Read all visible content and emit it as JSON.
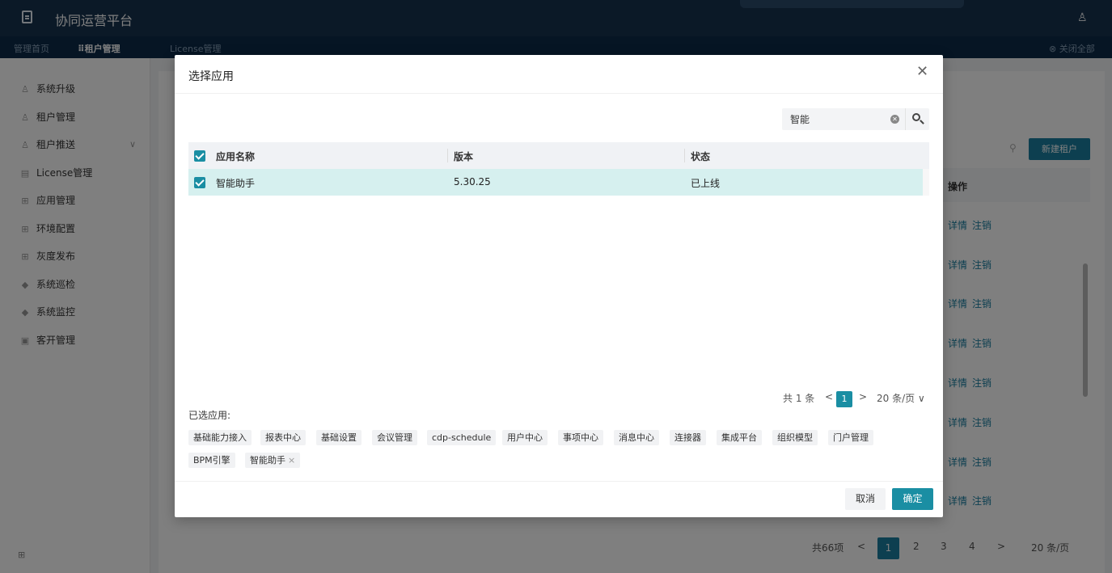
{
  "app": {
    "title": "协同运营平台"
  },
  "tabs": [
    {
      "label": "管理首页"
    },
    {
      "label": "⠿租户管理"
    },
    {
      "label": "License管理"
    }
  ],
  "close_all": "⊗ 关闭全部",
  "sidebar": {
    "items": [
      {
        "label": "系统升级",
        "icon": "user-icon"
      },
      {
        "label": "租户管理",
        "icon": "user-icon"
      },
      {
        "label": "租户推送",
        "icon": "user-icon"
      },
      {
        "label": "License管理",
        "icon": "license-icon"
      },
      {
        "label": "应用管理",
        "icon": "app-icon"
      },
      {
        "label": "环境配置",
        "icon": "app-icon"
      },
      {
        "label": "灰度发布",
        "icon": "grid-icon"
      },
      {
        "label": "系统巡检",
        "icon": "shield-icon"
      },
      {
        "label": "系统监控",
        "icon": "shield-icon"
      },
      {
        "label": "客开管理",
        "icon": "doc-icon"
      }
    ]
  },
  "background": {
    "new_tenant_label": "新建租户",
    "ops_header": "操作",
    "row_actions": [
      "详情",
      "注销"
    ],
    "pager": {
      "total": "共66项",
      "pages": [
        "1",
        "2",
        "3",
        "4"
      ],
      "page_size": "20 条/页"
    }
  },
  "modal": {
    "title": "选择应用",
    "search": {
      "value": "智能"
    },
    "table": {
      "headers": [
        "应用名称",
        "版本",
        "状态"
      ],
      "rows": [
        {
          "name": "智能助手",
          "version": "5.30.25",
          "status": "已上线"
        }
      ]
    },
    "pager": {
      "total": "共 1 条",
      "current": "1",
      "page_size": "20 条/页"
    },
    "selected_label": "已选应用:",
    "selected_apps": [
      "基础能力接入",
      "报表中心",
      "基础设置",
      "会议管理",
      "cdp-schedule",
      "用户中心",
      "事项中心",
      "消息中心",
      "连接器",
      "集成平台",
      "组织模型",
      "门户管理",
      "BPM引擎",
      "智能助手"
    ],
    "cancel_label": "取消",
    "ok_label": "确定"
  },
  "colors": {
    "accent": "#1a8ea3",
    "header_bg": "#16324f",
    "selected_row": "#d6f0ef"
  }
}
